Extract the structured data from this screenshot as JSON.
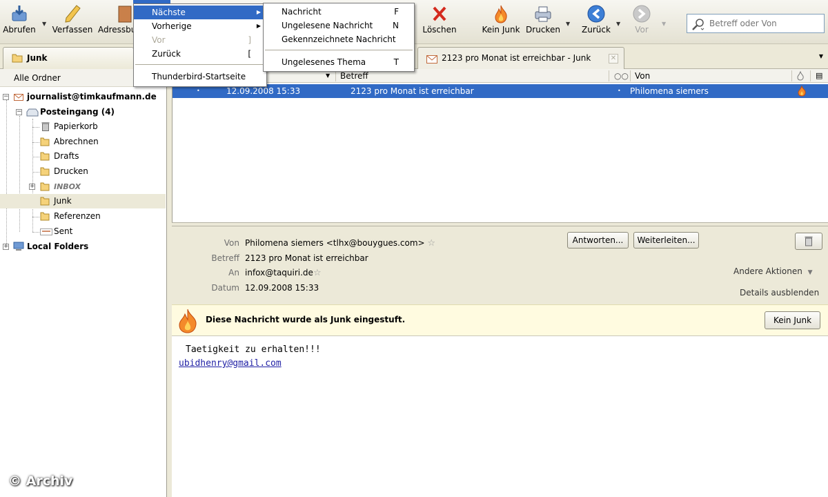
{
  "toolbar": {
    "abrufen": "Abrufen",
    "verfassen": "Verfassen",
    "adressbuch": "Adressbu",
    "loeschen": "Löschen",
    "kein_junk": "Kein Junk",
    "drucken": "Drucken",
    "zurueck": "Zurück",
    "vor": "Vor",
    "search_placeholder": "Betreff oder Von"
  },
  "tabs": {
    "active": "Junk",
    "second": "2123 pro Monat ist erreichbar - Junk"
  },
  "folders": {
    "header": "Alle Ordner",
    "account": "journalist@timkaufmann.de",
    "posteingang": "Posteingang (4)",
    "papierkorb": "Papierkorb",
    "abrechnen": "Abrechnen",
    "drafts": "Drafts",
    "drucken": "Drucken",
    "inbox": "INBOX",
    "junk": "Junk",
    "referenzen": "Referenzen",
    "sent": "Sent",
    "local_folders": "Local Folders"
  },
  "thread": {
    "col_betreff": "Betreff",
    "col_von": "Von",
    "row": {
      "date": "12.09.2008 15:33",
      "subject": "2123 pro Monat ist erreichbar",
      "from": "Philomena siemers"
    }
  },
  "message": {
    "von_label": "Von",
    "von_value": "Philomena siemers  <tlhx@bouygues.com>",
    "betreff_label": "Betreff",
    "betreff_value": "2123 pro Monat ist erreichbar",
    "an_label": "An",
    "an_value": "infox@taquiri.de",
    "datum_label": "Datum",
    "datum_value": "12.09.2008 15:33",
    "antworten": "Antworten...",
    "weiterleiten": "Weiterleiten...",
    "andere_aktionen": "Andere Aktionen",
    "details_ausblenden": "Details ausblenden",
    "junk_notice": "Diese Nachricht wurde als Junk eingestuft.",
    "kein_junk_button": "Kein Junk",
    "body_line1": "Taetigkeit zu erhalten!!!",
    "body_link": "ubidhenry@gmail.com"
  },
  "menu_go": {
    "naechste": "Nächste",
    "vorherige": "Vorherige",
    "vor": "Vor",
    "vor_shortcut": "]",
    "zurueck": "Zurück",
    "zurueck_shortcut": "[",
    "startseite": "Thunderbird-Startseite"
  },
  "menu_next": {
    "nachricht": "Nachricht",
    "nachricht_shortcut": "F",
    "ungelesene": "Ungelesene Nachricht",
    "ungelesene_shortcut": "N",
    "gekennzeichnete": "Gekennzeichnete Nachricht",
    "thema": "Ungelesenes Thema",
    "thema_shortcut": "T"
  },
  "watermark": "© Archiv",
  "colors": {
    "selection": "#316ac5",
    "junk_bar": "#fffbe0",
    "window_bg": "#ece9d8"
  }
}
